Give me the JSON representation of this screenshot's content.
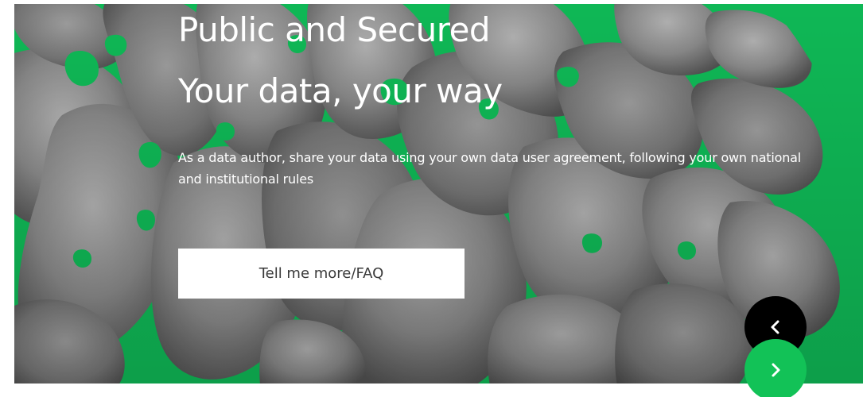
{
  "hero": {
    "title_line_1": "Public and Secured",
    "title_line_2": "Your data, your way",
    "description": "As a data author, share your data using your own data user agreement, following your own national and institutional rules",
    "cta_label": "Tell me more/FAQ",
    "background": {
      "image": "brain-surface-render",
      "colors": {
        "surface": "#8a8a8a",
        "accent": "#10c15a"
      }
    }
  },
  "carousel": {
    "prev_icon": "chevron-left-icon",
    "next_icon": "chevron-right-icon",
    "prev_color": "#000000",
    "next_color": "#12c257"
  }
}
